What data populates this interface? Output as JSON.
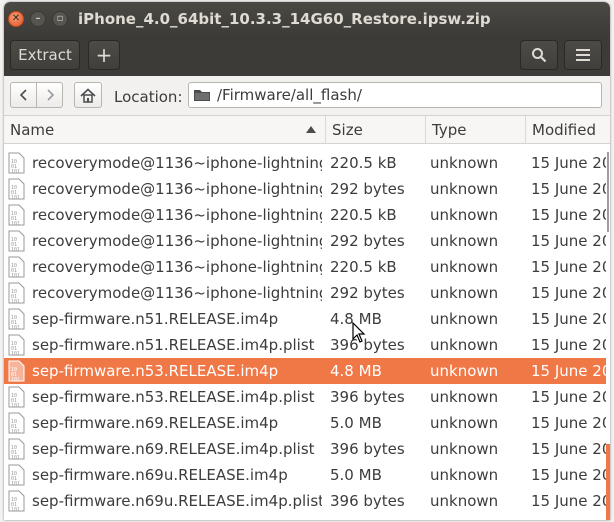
{
  "window": {
    "title": "iPhone_4.0_64bit_10.3.3_14G60_Restore.ipsw.zip"
  },
  "toolbar": {
    "extract_label": "Extract",
    "add_label": "+",
    "search_icon": "search-icon",
    "menu_icon": "hamburger-menu-icon"
  },
  "pathbar": {
    "location_label": "Location:",
    "location_value": "/Firmware/all_flash/"
  },
  "columns": {
    "name": "Name",
    "size": "Size",
    "type": "Type",
    "modified": "Modified"
  },
  "files": [
    {
      "name": "recoverymode@1136~iphone-lightning....",
      "size": "220.5 kB",
      "type": "unknown",
      "modified": "15 June 20"
    },
    {
      "name": "recoverymode@1136~iphone-lightning....",
      "size": "292 bytes",
      "type": "unknown",
      "modified": "15 June 20"
    },
    {
      "name": "recoverymode@1136~iphone-lightning....",
      "size": "220.5 kB",
      "type": "unknown",
      "modified": "15 June 20"
    },
    {
      "name": "recoverymode@1136~iphone-lightning....",
      "size": "292 bytes",
      "type": "unknown",
      "modified": "15 June 20"
    },
    {
      "name": "recoverymode@1136~iphone-lightning....",
      "size": "220.5 kB",
      "type": "unknown",
      "modified": "15 June 20"
    },
    {
      "name": "recoverymode@1136~iphone-lightning....",
      "size": "292 bytes",
      "type": "unknown",
      "modified": "15 June 20"
    },
    {
      "name": "sep-firmware.n51.RELEASE.im4p",
      "size": "4.8 MB",
      "type": "unknown",
      "modified": "15 June 20"
    },
    {
      "name": "sep-firmware.n51.RELEASE.im4p.plist",
      "size": "396 bytes",
      "type": "unknown",
      "modified": "15 June 20"
    },
    {
      "name": "sep-firmware.n53.RELEASE.im4p",
      "size": "4.8 MB",
      "type": "unknown",
      "modified": "15 June 20"
    },
    {
      "name": "sep-firmware.n53.RELEASE.im4p.plist",
      "size": "396 bytes",
      "type": "unknown",
      "modified": "15 June 20"
    },
    {
      "name": "sep-firmware.n69.RELEASE.im4p",
      "size": "5.0 MB",
      "type": "unknown",
      "modified": "15 June 20"
    },
    {
      "name": "sep-firmware.n69.RELEASE.im4p.plist",
      "size": "396 bytes",
      "type": "unknown",
      "modified": "15 June 20"
    },
    {
      "name": "sep-firmware.n69u.RELEASE.im4p",
      "size": "5.0 MB",
      "type": "unknown",
      "modified": "15 June 20"
    },
    {
      "name": "sep-firmware.n69u.RELEASE.im4p.plist",
      "size": "396 bytes",
      "type": "unknown",
      "modified": "15 June 20"
    }
  ],
  "selected_index": 8,
  "colors": {
    "accent": "#f07746",
    "titlebar": "#3c3b37"
  }
}
